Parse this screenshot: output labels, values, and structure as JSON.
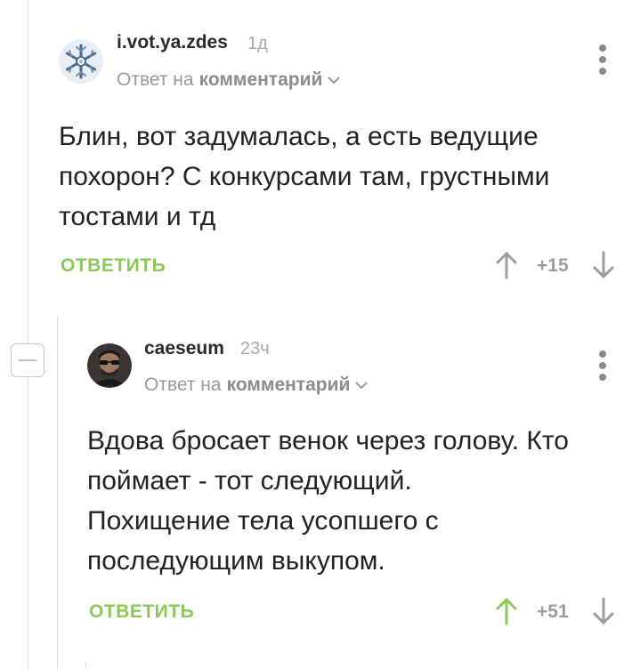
{
  "comments": [
    {
      "username": "i.vot.ya.zdes",
      "time": "1д",
      "reply_prefix": "Ответ на",
      "reply_link": "комментарий",
      "text_lines": [
        "Блин, вот задумалась, а есть ведущие",
        "похорон? С конкурсами там, грустными",
        "тостами и тд"
      ],
      "reply_label": "ОТВЕТИТЬ",
      "rating": "+15",
      "upvoted": false
    },
    {
      "username": "caeseum",
      "time": "23ч",
      "reply_prefix": "Ответ на",
      "reply_link": "комментарий",
      "text_lines": [
        "Вдова бросает венок через голову. Кто",
        "поймает - тот следующий.",
        "Похищение тела усопшего с",
        "последующим выкупом."
      ],
      "reply_label": "ОТВЕТИТЬ",
      "rating": "+51",
      "upvoted": true
    }
  ],
  "colors": {
    "accent_green": "#8ac858",
    "vote_gray": "#9c9c9c",
    "thread_line": "#d9d9d9"
  },
  "icons": {
    "collapse": "minus-icon",
    "menu": "vertical-dots-icon",
    "upvote": "arrow-up-icon",
    "downvote": "arrow-down-icon",
    "chevron": "chevron-down-icon"
  }
}
